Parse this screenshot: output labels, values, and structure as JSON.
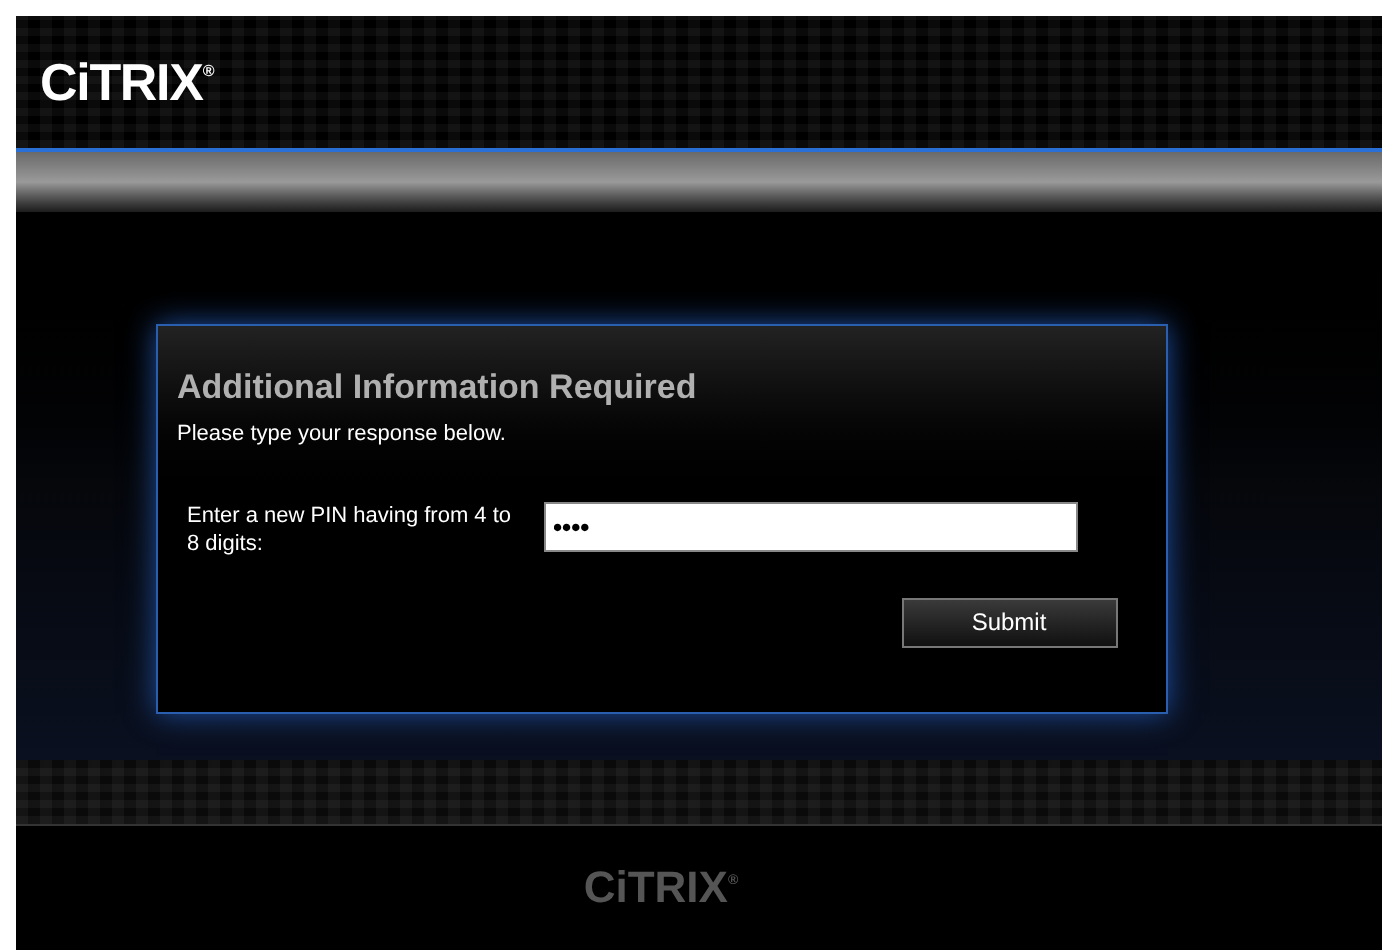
{
  "header": {
    "logo": "CiTRIX",
    "logo_mark": "®"
  },
  "dialog": {
    "title": "Additional Information Required",
    "subtitle": "Please type your response below.",
    "field_label": "Enter a new PIN having from 4 to 8 digits:",
    "field_value": "••••",
    "button": "Submit"
  },
  "footer": {
    "logo": "CiTRIX",
    "logo_mark": "®"
  }
}
